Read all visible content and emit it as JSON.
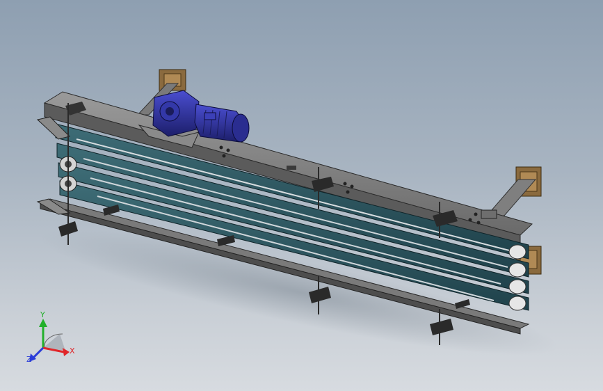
{
  "triad": {
    "x_label": "X",
    "y_label": "Y",
    "z_label": "Z",
    "x_color": "#e0262a",
    "y_color": "#22b02a",
    "z_color": "#2a3cd8"
  },
  "colors": {
    "background_top": "#8e9fb1",
    "background_bottom": "#d7dbe0",
    "frame_gray": "#6f6f6f",
    "belt_teal": "#2f5c66",
    "motor_blue": "#2c2f9a",
    "mount_plate_brown": "#8a6a3e"
  }
}
